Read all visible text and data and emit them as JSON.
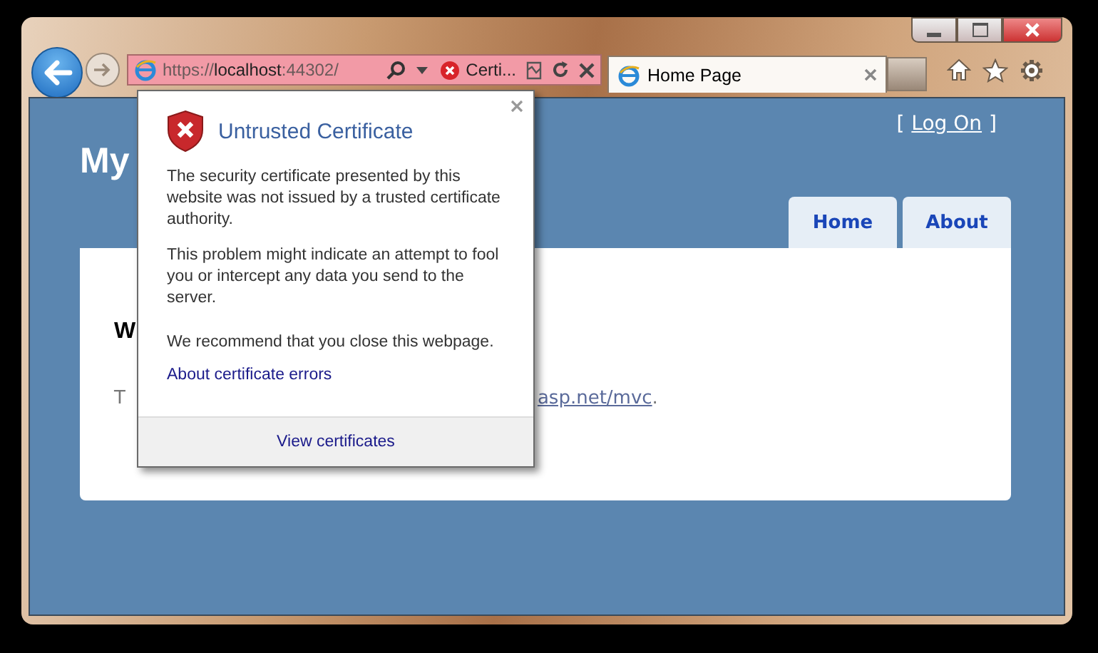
{
  "browser": {
    "address": {
      "scheme": "https://",
      "host": "localhost",
      "rest": ":44302/",
      "certificate_label": "Certi..."
    },
    "tabs": [
      {
        "title": "Home Page",
        "selected": true
      }
    ]
  },
  "page": {
    "heading": "My",
    "login": {
      "open": "[",
      "link": "Log On",
      "close": "]"
    },
    "nav": [
      {
        "label": "Home"
      },
      {
        "label": "About"
      }
    ],
    "main": {
      "heading_visible": "W",
      "text_visible": "T",
      "link": "asp.net/mvc",
      "after_link": "."
    }
  },
  "popup": {
    "title": "Untrusted Certificate",
    "paragraphs": [
      "The security certificate presented by this website was not issued by a trusted certificate authority.",
      "This problem might indicate an attempt to fool you or intercept any data you send to the server.",
      "We recommend that you close this webpage."
    ],
    "link": "About certificate errors",
    "footer_link": "View certificates"
  }
}
